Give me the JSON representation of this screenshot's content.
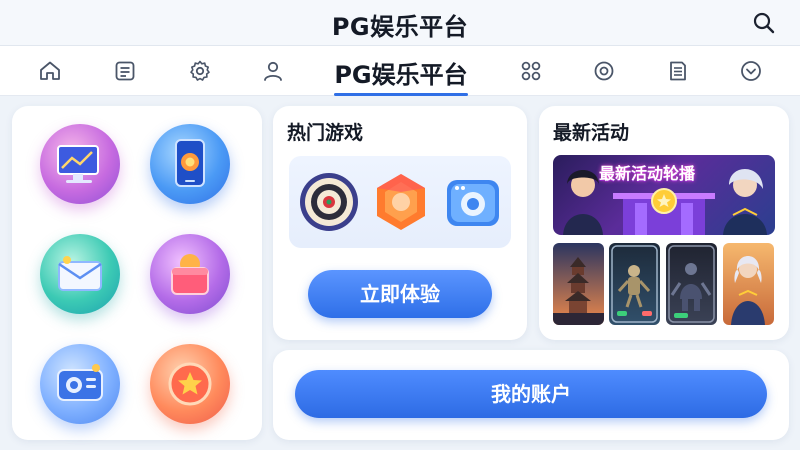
{
  "header": {
    "title": "PG娱乐平台",
    "search_icon": "search-icon"
  },
  "nav": {
    "active_label": "PG娱乐平台",
    "icons": [
      "home-icon",
      "document-icon",
      "settings-icon",
      "user-icon",
      "grid-icon",
      "target-icon",
      "notes-icon",
      "chevron-down-icon"
    ]
  },
  "left_panel": {
    "apps": [
      "monitor-app-icon",
      "phone-app-icon",
      "mail-app-icon",
      "gift-bag-app-icon",
      "camera-app-icon",
      "star-coin-app-icon"
    ]
  },
  "hot_games": {
    "title": "热门游戏",
    "games": [
      "dartboard-icon",
      "orange-gem-icon",
      "blue-device-icon"
    ],
    "cta_label": "立即体验"
  },
  "activities": {
    "title": "最新活动",
    "banner_text": "最新活动轮播",
    "thumbnails": [
      "pagoda-thumbnail",
      "robot-phone-thumbnail",
      "warrior-phone-thumbnail",
      "heroine-thumbnail"
    ]
  },
  "account": {
    "button_label": "我的账户"
  },
  "colors": {
    "accent": "#2f6fe6",
    "background": "#eef3f9",
    "card": "#ffffff"
  }
}
